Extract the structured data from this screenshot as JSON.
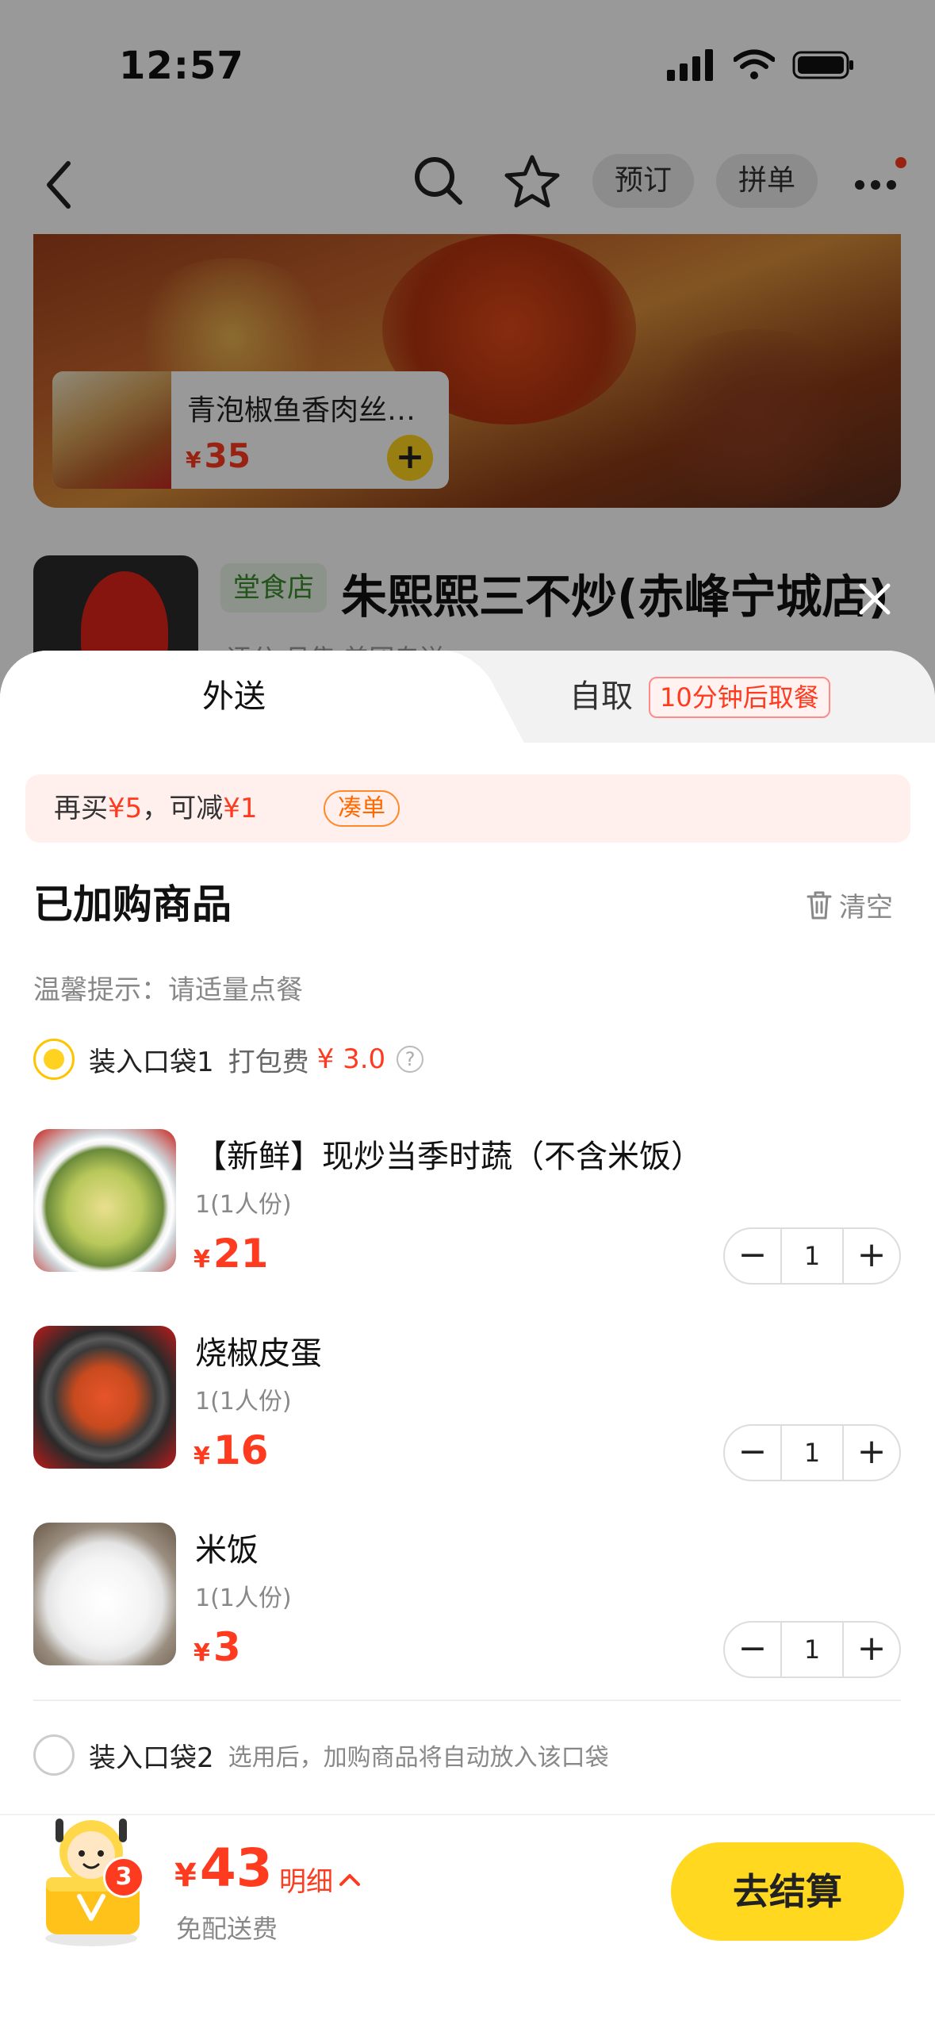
{
  "status_bar": {
    "time": "12:57"
  },
  "nav": {
    "reserve_label": "预订",
    "group_label": "拼单"
  },
  "promo_card": {
    "name": "青泡椒鱼香肉丝…",
    "currency": "¥",
    "price": "35"
  },
  "shop": {
    "tag": "堂食店",
    "name": "朱熙熙三不炒(赤峰宁城店)",
    "sub": "评分      月售      美团专送"
  },
  "tabs": {
    "delivery": "外送",
    "pickup": "自取",
    "pickup_badge": "10分钟后取餐"
  },
  "promo_bar": {
    "prefix": "再买",
    "amount1": "¥5",
    "middle": "，可减",
    "amount2": "¥1",
    "chip": "凑单"
  },
  "cart": {
    "title": "已加购商品",
    "clear_label": "清空",
    "tip": "温馨提示：请适量点餐",
    "bag1": {
      "label": "装入口袋1",
      "fee_label": "打包费",
      "fee_value": "¥ 3.0",
      "help": "?"
    },
    "items": [
      {
        "name": "【新鲜】现炒当季时蔬（不含米饭）",
        "spec": "1(1人份)",
        "currency": "¥",
        "price": "21",
        "qty": "1"
      },
      {
        "name": "烧椒皮蛋",
        "spec": "1(1人份)",
        "currency": "¥",
        "price": "16",
        "qty": "1"
      },
      {
        "name": "米饭",
        "spec": "1(1人份)",
        "currency": "¥",
        "price": "3",
        "qty": "1"
      }
    ],
    "bag2": {
      "label": "装入口袋2",
      "hint": "选用后，加购商品将自动放入该口袋"
    }
  },
  "bottom": {
    "badge_count": "3",
    "currency": "¥",
    "total": "43",
    "detail_label": "明细",
    "free_delivery": "免配送费",
    "checkout_label": "去结算"
  },
  "colors": {
    "accent_red": "#ff3b1f",
    "accent_yellow": "#ffd81f"
  },
  "icons": [
    "back-icon",
    "search-icon",
    "star-icon",
    "more-icon",
    "trash-icon",
    "close-icon",
    "chevron-up-icon",
    "plus-icon",
    "minus-icon"
  ]
}
